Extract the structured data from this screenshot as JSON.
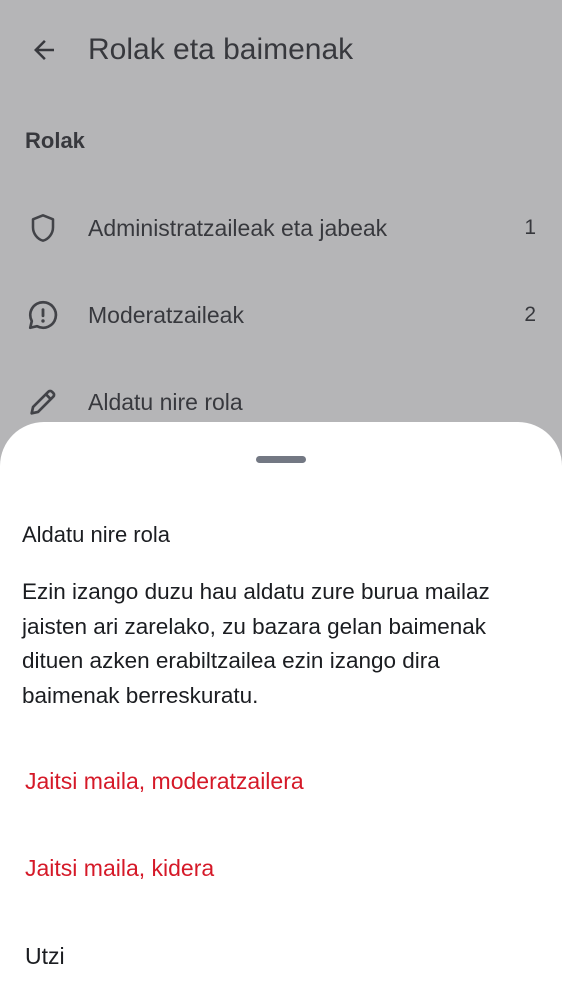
{
  "header": {
    "title": "Rolak eta baimenak",
    "back_icon": "arrow-left-icon"
  },
  "roles_section": {
    "title": "Rolak",
    "items": [
      {
        "label": "Administratzaileak eta jabeak",
        "count": "1",
        "icon": "shield-icon"
      },
      {
        "label": "Moderatzaileak",
        "count": "2",
        "icon": "chat-alert-icon"
      },
      {
        "label": "Aldatu nire rola",
        "count": "",
        "icon": "pencil-icon"
      }
    ]
  },
  "dialog": {
    "title": "Aldatu nire rola",
    "body": "Ezin izango duzu hau aldatu zure burua mailaz jaisten ari zarelako, zu bazara gelan baimenak dituen azken erabiltzailea ezin izango dira baimenak berreskuratu.",
    "options": [
      {
        "label": "Jaitsi maila, moderatzailera",
        "kind": "danger"
      },
      {
        "label": "Jaitsi maila, kidera",
        "kind": "danger"
      },
      {
        "label": "Utzi",
        "kind": "neutral"
      }
    ]
  },
  "colors": {
    "danger": "#d51928",
    "text": "#1b1d21",
    "scrim": "#5a5c60",
    "handle": "#737883"
  }
}
